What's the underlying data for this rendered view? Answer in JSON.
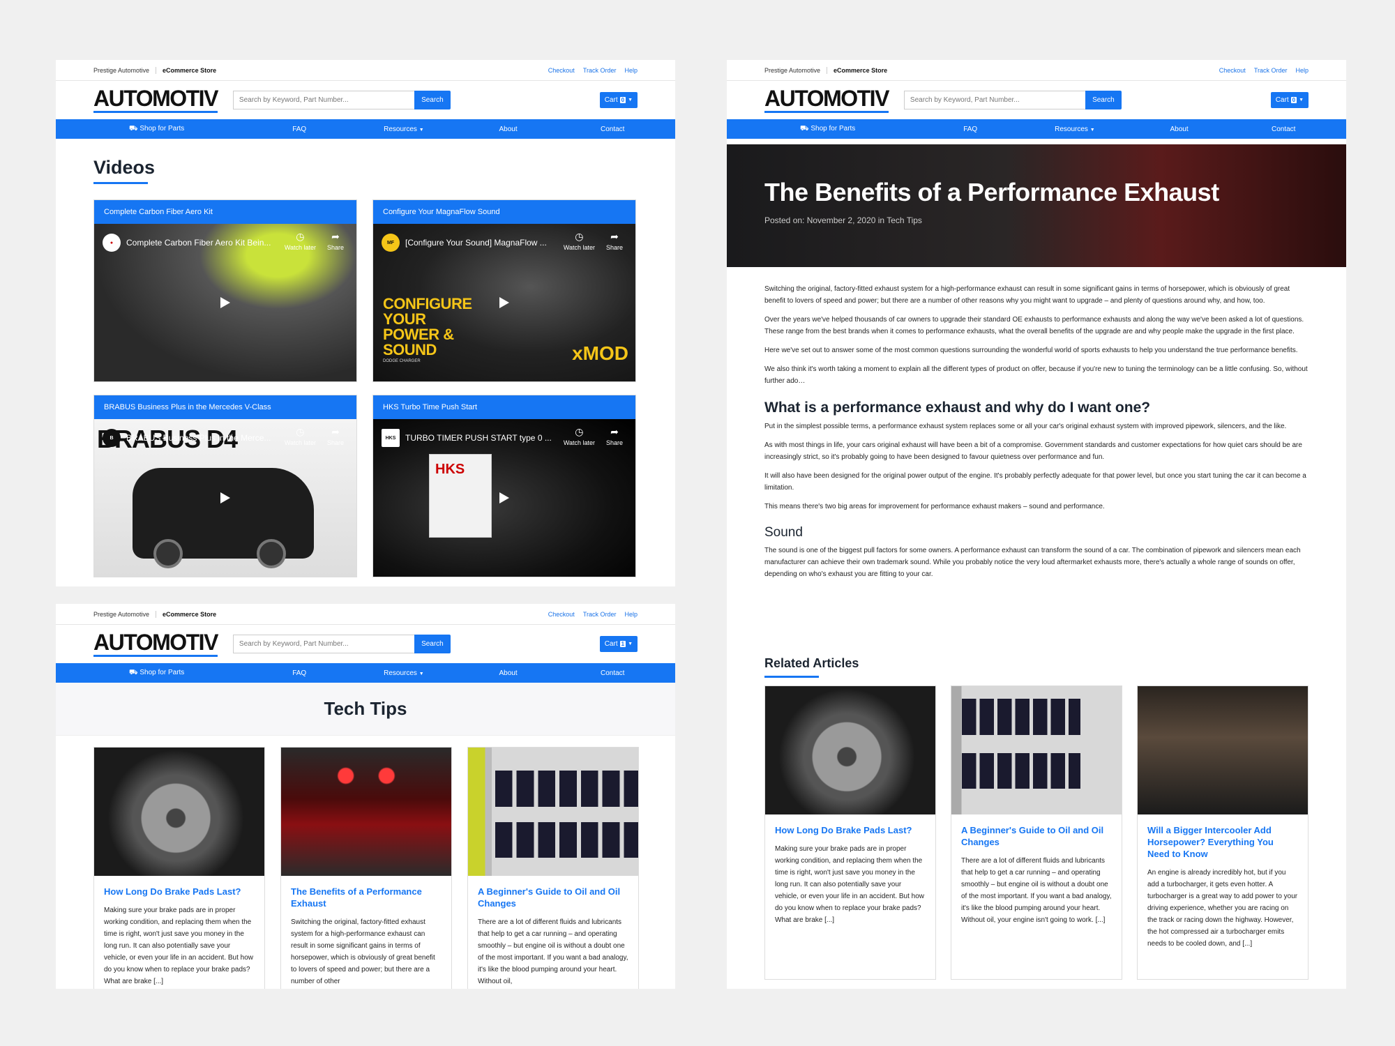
{
  "common": {
    "top_left_a": "Prestige Automotive",
    "top_left_b": "eCommerce Store",
    "top_links": [
      "Checkout",
      "Track Order",
      "Help"
    ],
    "logo": "AUTOMOTIV",
    "search_placeholder": "Search by Keyword, Part Number...",
    "search_button": "Search",
    "cart_label": "Cart",
    "nav": [
      "Shop for Parts",
      "FAQ",
      "Resources",
      "About",
      "Contact"
    ]
  },
  "cart_counts": {
    "videos": "0",
    "tech": "1",
    "article": "0"
  },
  "videos_page": {
    "title": "Videos",
    "items": [
      {
        "card_title": "Complete Carbon Fiber Aero Kit",
        "video_title": "Complete Carbon Fiber Aero Kit Bein...",
        "watch": "Watch later",
        "share": "Share"
      },
      {
        "card_title": "Configure Your MagnaFlow Sound",
        "video_title": "[Configure Your Sound] MagnaFlow ...",
        "watch": "Watch later",
        "share": "Share",
        "overlay": "CONFIGURE YOUR POWER & SOUND",
        "overlay_sub": "DODGE CHARGER",
        "brand": "xMOD"
      },
      {
        "card_title": "BRABUS Business Plus in the Mercedes V-Class",
        "video_title": "BRABUS Business Plus in the Merce...",
        "watch": "Watch later",
        "share": "Share",
        "overlay": "BRABUS D4"
      },
      {
        "card_title": "HKS Turbo Time Push Start",
        "video_title": "TURBO TIMER PUSH START type 0 ...",
        "watch": "Watch later",
        "share": "Share"
      }
    ]
  },
  "tech_page": {
    "title": "Tech Tips",
    "items": [
      {
        "title": "How Long Do Brake Pads Last?",
        "text": "Making sure your brake pads are in proper working condition, and replacing them when the time is right, won't just save you money in the long run. It can also potentially save your vehicle, or even your life in an accident. But how do you know when to replace your brake pads? What are brake [...]"
      },
      {
        "title": "The Benefits of a Performance Exhaust",
        "text": "Switching the original, factory-fitted exhaust system for a high-performance exhaust can result in some significant gains in terms of horsepower, which is obviously of great benefit to lovers of speed and power; but there are a number of other"
      },
      {
        "title": "A Beginner's Guide to Oil and Oil Changes",
        "text": "There are a lot of different fluids and lubricants that help to get a car running – and operating smoothly – but engine oil is without a doubt one of the most important. If you want a bad analogy, it's like the blood pumping around your heart. Without oil,"
      }
    ]
  },
  "article_page": {
    "title": "The Benefits of a Performance Exhaust",
    "meta": "Posted on: November 2, 2020 in Tech Tips",
    "paragraphs": [
      "Switching the original, factory-fitted exhaust system for a high-performance exhaust can result in some significant gains in terms of horsepower, which is obviously of great benefit to lovers of speed and power; but there are a number of other reasons why you might want to upgrade – and plenty of questions around why, and how, too.",
      "Over the years we've helped thousands of car owners to upgrade their standard OE exhausts to performance exhausts and along the way we've been asked a lot of questions. These range from the best brands when it comes to performance exhausts, what the overall benefits of the upgrade are and why people make the upgrade in the first place.",
      "Here we've set out to answer some of the most common questions surrounding the wonderful world of sports exhausts to help you understand the true performance benefits.",
      "We also think it's worth taking a moment to explain all the different types of product on offer, because if you're new to tuning the terminology can be a little confusing. So, without further ado…"
    ],
    "h2": "What is a performance exhaust and why do I want one?",
    "paragraphs2": [
      "Put in the simplest possible terms, a performance exhaust system replaces some or all your car's original exhaust system with improved pipework, silencers, and the like.",
      "As with most things in life, your cars original exhaust will have been a bit of a compromise. Government standards and customer expectations for how quiet cars should be are increasingly strict, so it's probably going to have been designed to favour quietness over performance and fun.",
      "It will also have been designed for the original power output of the engine. It's probably perfectly adequate for that power level, but once you start tuning the car it can become a limitation.",
      "This means there's two big areas for improvement for performance exhaust makers – sound and performance."
    ],
    "h3": "Sound",
    "paragraphs3": [
      "The sound is one of the biggest pull factors for some owners. A performance exhaust can transform the sound of a car. The combination of pipework and silencers mean each manufacturer can achieve their own trademark sound. While you probably notice the very loud aftermarket exhausts more, there's actually a whole range of sounds on offer, depending on who's exhaust you are fitting to your car."
    ],
    "related_title": "Related Articles",
    "related": [
      {
        "title": "How Long Do Brake Pads Last?",
        "text": "Making sure your brake pads are in proper working condition, and replacing them when the time is right, won't just save you money in the long run. It can also potentially save your vehicle, or even your life in an accident. But how do you know when to replace your brake pads? What are brake [...]"
      },
      {
        "title": "A Beginner's Guide to Oil and Oil Changes",
        "text": "There are a lot of different fluids and lubricants that help to get a car running – and operating smoothly – but engine oil is without a doubt one of the most important. If you want a bad analogy, it's like the blood pumping around your heart. Without oil, your engine isn't going to work. [...]"
      },
      {
        "title": "Will a Bigger Intercooler Add Horsepower? Everything You Need to Know",
        "text": "An engine is already incredibly hot, but if you add a turbocharger, it gets even hotter. A turbocharger is a great way to add power to your driving experience, whether you are racing on the track or racing down the highway. However, the hot compressed air a turbocharger emits needs to be cooled down, and [...]"
      }
    ]
  }
}
